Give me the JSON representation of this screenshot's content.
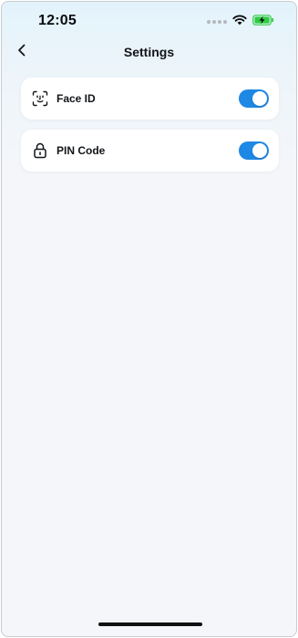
{
  "status_bar": {
    "time": "12:05",
    "icons": [
      "cellular-signal-icon",
      "wifi-icon",
      "battery-charging-icon"
    ]
  },
  "nav": {
    "title": "Settings",
    "back_icon": "chevron-left-icon"
  },
  "settings": [
    {
      "label": "Face ID",
      "icon": "face-id-icon",
      "enabled": true
    },
    {
      "label": "PIN Code",
      "icon": "lock-icon",
      "enabled": true
    }
  ],
  "colors": {
    "toggle_on": "#1e88e5",
    "battery": "#2ecc40",
    "background_top": "#e3f3fb",
    "background": "#f5f6fa"
  }
}
